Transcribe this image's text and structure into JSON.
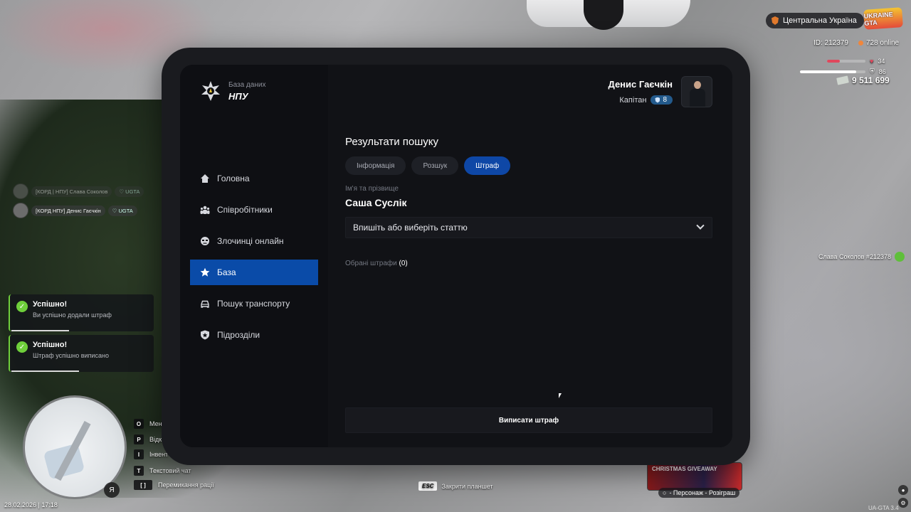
{
  "hud": {
    "region": "Центральна Україна",
    "logo_text": "UKRAINE GTA",
    "player_id": "ID: 212379",
    "online": "728 online",
    "health_value": "34",
    "health_fraction": 0.34,
    "armor_value": "86",
    "armor_fraction": 0.86,
    "money": "9 511 699",
    "health_color": "#e0475c",
    "armor_color": "#ffffff"
  },
  "chat": [
    {
      "name": "[КОРД | НПУ] Слава Соколов",
      "tag": "UGTA"
    },
    {
      "name": "[КОРД НПУ] Денис Гаєчкін",
      "tag": "UGTA"
    }
  ],
  "notifications": [
    {
      "title": "Успішно!",
      "text": "Ви успішно додали штраф",
      "progress": 0.4
    },
    {
      "title": "Успішно!",
      "text": "Штраф успішно виписано",
      "progress": 0.47
    }
  ],
  "keybinds": [
    {
      "key": "O",
      "label": "Мени"
    },
    {
      "key": "P",
      "label": "Відк"
    },
    {
      "key": "I",
      "label": "Інвент"
    },
    {
      "key": "T",
      "label": "Текстовий чат"
    },
    {
      "key": "[ ]",
      "label": "Перемикання рації"
    }
  ],
  "date": "28.02.2026 | 17:18",
  "mic_label": "Я",
  "esc_hint": {
    "key": "ESC",
    "label": "Закрити планшет"
  },
  "giveaway": {
    "title": "CHRISTMAS GIVEAWAY",
    "label": "- Персонаж - Розіграш"
  },
  "nametag": "Слава Соколов #212378",
  "version": "UA-GTA 3.4",
  "tablet": {
    "brand_sub": "База даних",
    "brand_title": "НПУ",
    "user_name": "Денис Гаєчкін",
    "user_rank": "Капітан",
    "rank_level": "8",
    "nav": [
      {
        "label": "Головна",
        "icon": "home-icon"
      },
      {
        "label": "Співробітники",
        "icon": "people-icon"
      },
      {
        "label": "Злочинці онлайн",
        "icon": "criminal-icon"
      },
      {
        "label": "База",
        "icon": "star-icon",
        "active": true
      },
      {
        "label": "Пошук транспорту",
        "icon": "car-icon"
      },
      {
        "label": "Підрозділи",
        "icon": "shield-icon"
      }
    ],
    "section_title": "Результати пошуку",
    "tabs": [
      {
        "label": "Інформація"
      },
      {
        "label": "Розшук"
      },
      {
        "label": "Штраф",
        "active": true
      }
    ],
    "field_label": "Ім'я та прізвище",
    "person_name": "Саша Суслік",
    "select_placeholder": "Впишіть або виберіть статтю",
    "fines_label": "Обрані штрафи",
    "fines_count": "(0)",
    "submit_label": "Виписати штраф",
    "accent": "#0a4ba8"
  }
}
